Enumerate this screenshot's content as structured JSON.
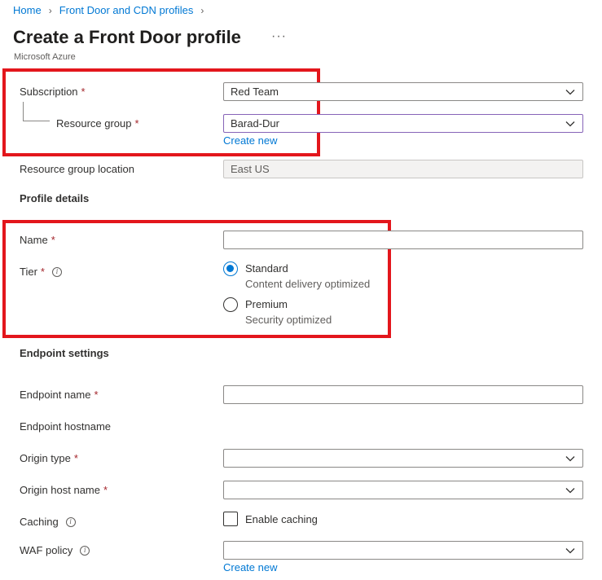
{
  "breadcrumb": {
    "home": "Home",
    "profiles": "Front Door and CDN profiles"
  },
  "page": {
    "title": "Create a Front Door profile",
    "more": "···",
    "subtitle": "Microsoft Azure"
  },
  "project": {
    "subscription_label": "Subscription",
    "subscription_value": "Red Team",
    "resource_group_label": "Resource group",
    "resource_group_value": "Barad-Dur",
    "create_new": "Create new",
    "location_label": "Resource group location",
    "location_value": "East US"
  },
  "profile": {
    "heading": "Profile details",
    "name_label": "Name",
    "name_value": "",
    "tier_label": "Tier",
    "tiers": [
      {
        "title": "Standard",
        "desc": "Content delivery optimized",
        "selected": true
      },
      {
        "title": "Premium",
        "desc": "Security optimized",
        "selected": false
      }
    ]
  },
  "endpoint": {
    "heading": "Endpoint settings",
    "endpoint_name_label": "Endpoint name",
    "endpoint_name_value": "",
    "hostname_label": "Endpoint hostname",
    "origin_type_label": "Origin type",
    "origin_type_value": "",
    "origin_host_label": "Origin host name",
    "origin_host_value": "",
    "caching_label": "Caching",
    "caching_checkbox_label": "Enable caching",
    "caching_enabled": false,
    "waf_label": "WAF policy",
    "waf_value": "",
    "waf_create_new": "Create new"
  },
  "colors": {
    "accent": "#0078d4",
    "required": "#a4262c",
    "highlight_box": "#e3161c",
    "focus_border": "#8764b8"
  }
}
